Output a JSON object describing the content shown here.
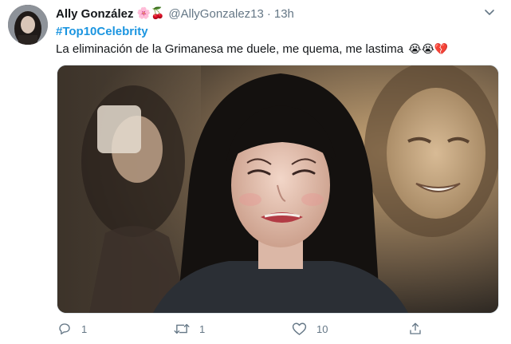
{
  "user": {
    "display_name": "Ally González",
    "name_emojis": "🌸🍒",
    "handle": "@AllyGonzalez13",
    "separator": "·",
    "time": "13h"
  },
  "tweet": {
    "hashtag": "#Top10Celebrity",
    "text": "La eliminación de la Grimanesa me duele, me quema, me lastima",
    "text_emojis": "😭😭💔"
  },
  "media": {
    "icon": "photo-collage-crying-woman"
  },
  "actions": {
    "reply_count": "1",
    "retweet_count": "1",
    "like_count": "10"
  },
  "colors": {
    "link": "#1b95e0",
    "secondary_text": "#657786",
    "primary_text": "#14171a",
    "border": "#e1e8ed"
  }
}
